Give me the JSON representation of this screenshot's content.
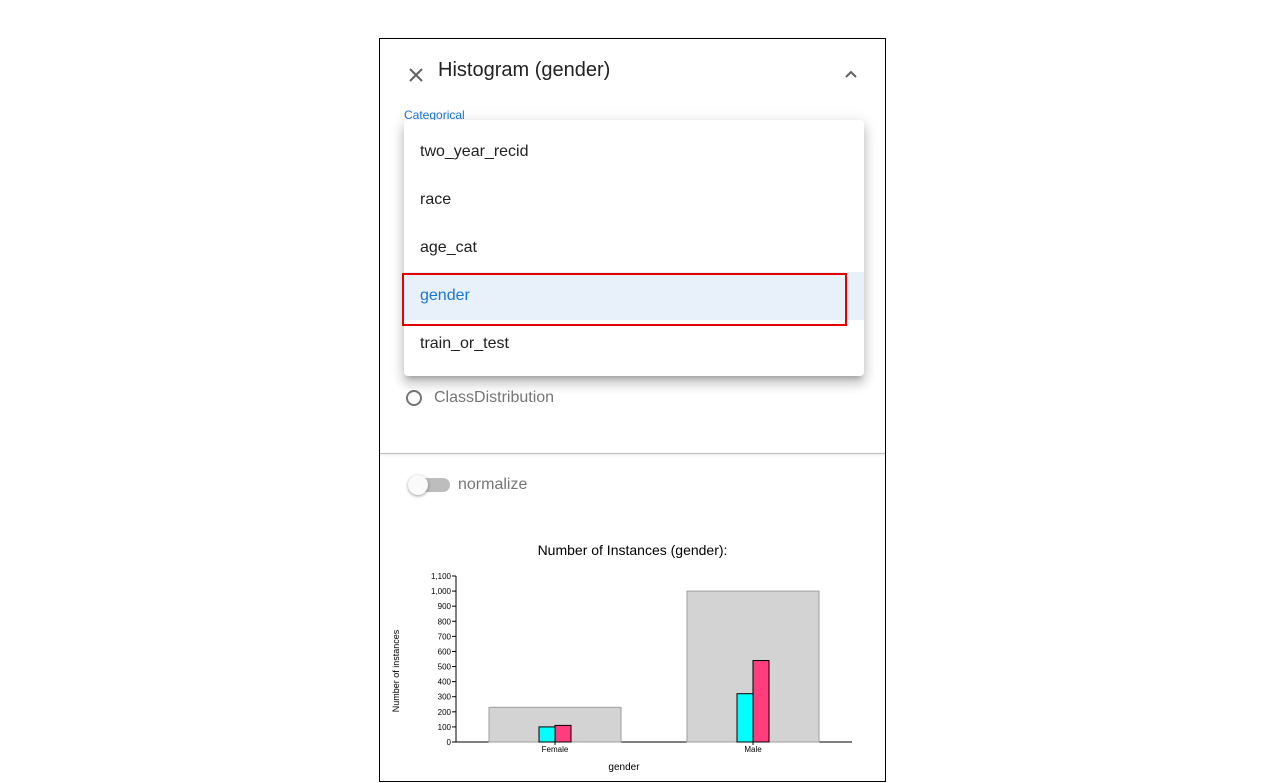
{
  "panel": {
    "title": "Histogram (gender)",
    "field_label": "Categorical",
    "radio_option": "ClassDistribution",
    "toggle_label": "normalize",
    "toggle_on": false
  },
  "menu": {
    "items": [
      "two_year_recid",
      "race",
      "age_cat",
      "gender",
      "train_or_test"
    ],
    "selected_index": 3
  },
  "chart_data": {
    "type": "bar",
    "title": "Number of Instances (gender):",
    "xlabel": "gender",
    "ylabel": "Number of instances",
    "categories": [
      "Female",
      "Male"
    ],
    "ylim": [
      0,
      1100
    ],
    "yticks": [
      "0",
      "100",
      "200",
      "300",
      "400",
      "500",
      "600",
      "700",
      "800",
      "900",
      "1,000",
      "1,100"
    ],
    "series": [
      {
        "values": [
          230,
          1000
        ],
        "color": "#d3d3d3"
      },
      {
        "values": [
          100,
          320
        ],
        "color": "#00ffff"
      },
      {
        "values": [
          110,
          540
        ],
        "color": "#ff3d7f"
      }
    ]
  },
  "colors": {
    "accent": "#1976d2",
    "highlight_border": "#e50000"
  }
}
